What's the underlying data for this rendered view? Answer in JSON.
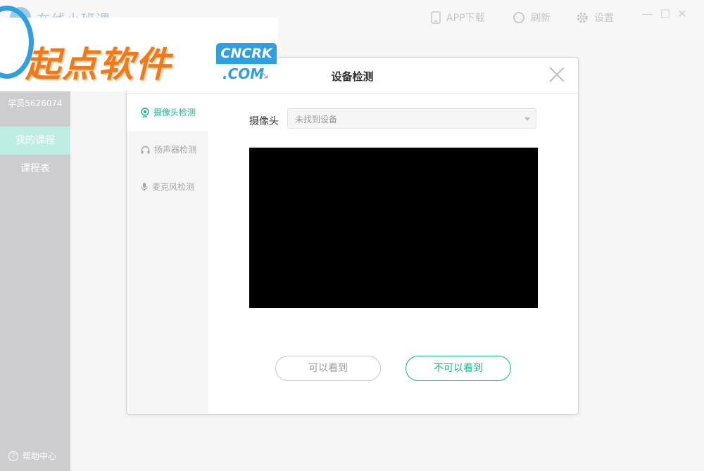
{
  "app": {
    "title": "在线小班课"
  },
  "topbar": {
    "app_download": "APP下载",
    "refresh": "刷新",
    "settings": "设置"
  },
  "sidebar": {
    "user_id": "学员5626074",
    "items": [
      {
        "label": "我的课程",
        "active": true
      },
      {
        "label": "课程表",
        "active": false
      }
    ],
    "help": "帮助中心"
  },
  "dialog": {
    "title": "设备检测",
    "nav": [
      {
        "label": "摄像头检测",
        "icon": "camera-icon",
        "active": true
      },
      {
        "label": "扬声器检测",
        "icon": "headphones-icon",
        "active": false
      },
      {
        "label": "麦克风检测",
        "icon": "microphone-icon",
        "active": false
      }
    ],
    "camera_label": "摄像头",
    "camera_select_value": "未找到设备",
    "can_see": "可以看到",
    "cannot_see": "不可以看到"
  },
  "watermark": {
    "text": "起点软件",
    "badge": "CNCRK",
    "com": ".COM",
    "arrow": "↘"
  },
  "colors": {
    "accent": "#19b68c",
    "sidebar": "#cdcdd1",
    "active_item": "#bdeee3",
    "watermark_orange": "#f07a1a",
    "watermark_blue": "#2e9fe0"
  }
}
